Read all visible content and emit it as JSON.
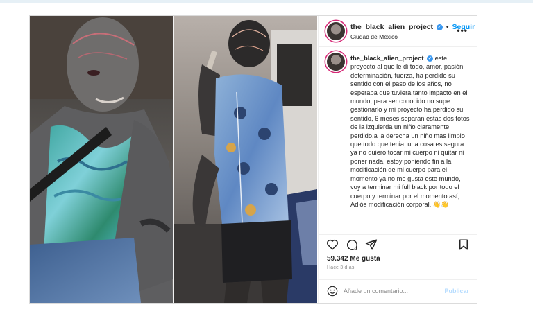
{
  "post": {
    "username": "the_black_alien_project",
    "verified_icon": "verified-badge-icon",
    "separator": "•",
    "follow_label": "Seguir",
    "location": "Ciudad de México",
    "more_label": "•••",
    "caption": "este proyecto al que le di todo, amor, pasión, determinación, fuerza, ha perdido su sentido con el paso de los años, no esperaba que tuviera tanto impacto en el mundo, para ser conocido no supe gestionarlo y mi proyecto ha perdido su sentido, 6 meses separan estas dos fotos de la izquierda un niño claramente perdido,a la derecha un niño mas limpio que todo que tenia, una cosa es segura ya no quiero tocar mi cuerpo ni quitar ni poner nada, estoy poniendo fin a la modificación de mi cuerpo para el momento ya no me gusta este mundo, voy a terminar mi full black por todo el cuerpo y terminar por el momento así, Adiós modificación corporal. 👋👋",
    "likes": "59.342 Me gusta",
    "time_ago": "Hace 3 días",
    "comment_placeholder": "Añade un comentario...",
    "publish_label": "Publicar"
  },
  "icons": {
    "like": "heart-icon",
    "comment": "comment-icon",
    "share": "send-icon",
    "save": "bookmark-icon",
    "emoji": "emoji-icon"
  },
  "colors": {
    "accent": "#0095f6",
    "verified": "#3897f0",
    "text": "#262626",
    "muted": "#8e8e8e"
  }
}
